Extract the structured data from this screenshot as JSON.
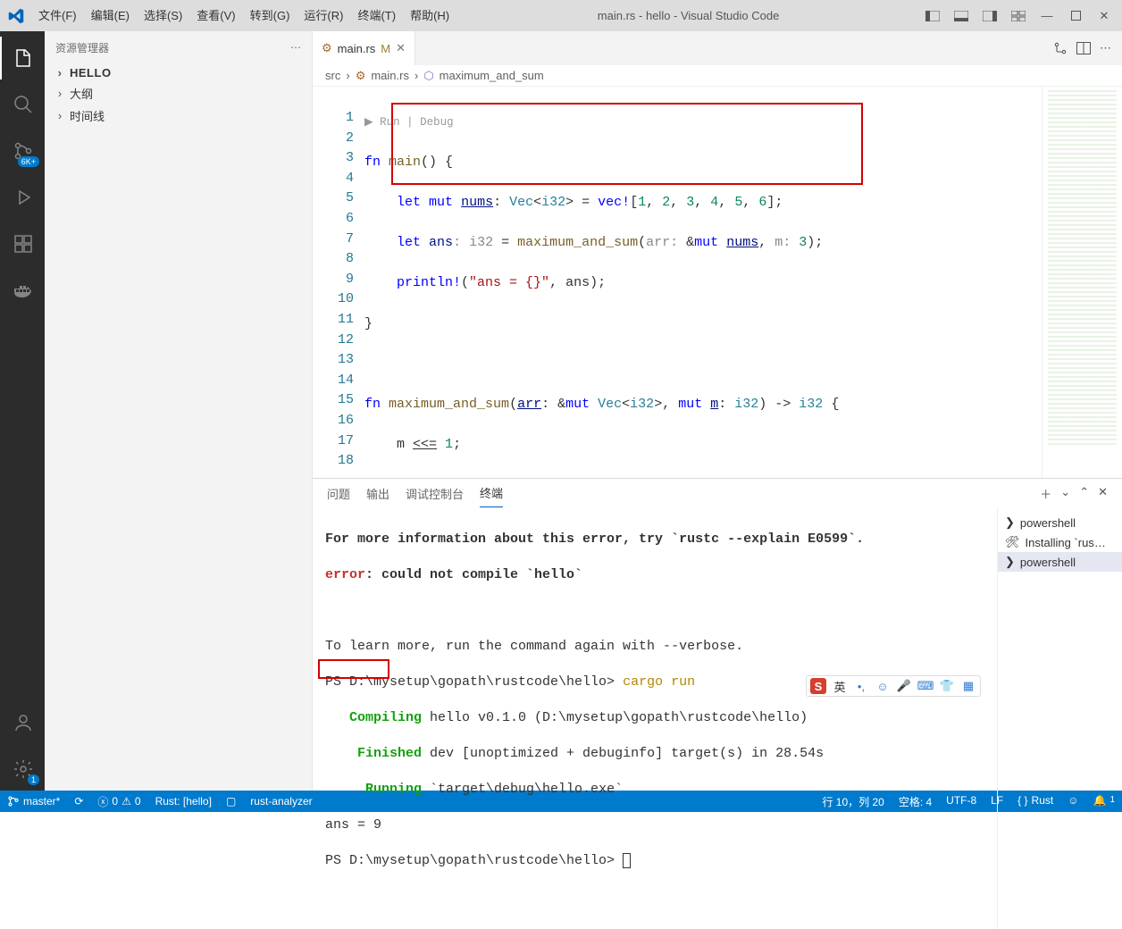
{
  "title": "main.rs - hello - Visual Studio Code",
  "menu": [
    "文件(F)",
    "编辑(E)",
    "选择(S)",
    "查看(V)",
    "转到(G)",
    "运行(R)",
    "终端(T)",
    "帮助(H)"
  ],
  "sidebar": {
    "title": "资源管理器",
    "sections": [
      "HELLO",
      "大纲",
      "时间线"
    ]
  },
  "activity": {
    "scm_badge": "6K+",
    "settings_badge": "1"
  },
  "tab": {
    "filename": "main.rs",
    "modified": "M"
  },
  "breadcrumb": {
    "folder": "src",
    "file": "main.rs",
    "symbol": "maximum_and_sum"
  },
  "codelens": "▶ Run | Debug",
  "code": {
    "lines": 18
  },
  "panel": {
    "tabs": [
      "问题",
      "输出",
      "调试控制台",
      "终端"
    ],
    "active": 3
  },
  "terminal_sessions": [
    "powershell",
    "Installing `rus…",
    "powershell"
  ],
  "terminal": {
    "l1": "For more information about this error, try `rustc --explain E0599`.",
    "l2a": "error",
    "l2b": ": could not compile `hello`",
    "l3": "To learn more, run the command again with --verbose.",
    "l4a": "PS D:\\mysetup\\gopath\\rustcode\\hello> ",
    "l4b": "cargo run",
    "l5a": "   Compiling",
    "l5b": " hello v0.1.0 (D:\\mysetup\\gopath\\rustcode\\hello)",
    "l6a": "    Finished",
    "l6b": " dev [unoptimized + debuginfo] target(s) in 28.54s",
    "l7a": "     Running",
    "l7b": " `target\\debug\\hello.exe`",
    "l8": "ans = 9",
    "l9": "PS D:\\mysetup\\gopath\\rustcode\\hello> "
  },
  "status": {
    "branch": "master*",
    "errors": "0",
    "warnings": "0",
    "rust": "Rust: [hello]",
    "analyzer": "rust-analyzer",
    "pos": "行 10，列 20",
    "spaces": "空格: 4",
    "encoding": "UTF-8",
    "eol": "LF",
    "lang": "Rust",
    "feedback_count": "1"
  },
  "ime": {
    "lang": "英"
  }
}
